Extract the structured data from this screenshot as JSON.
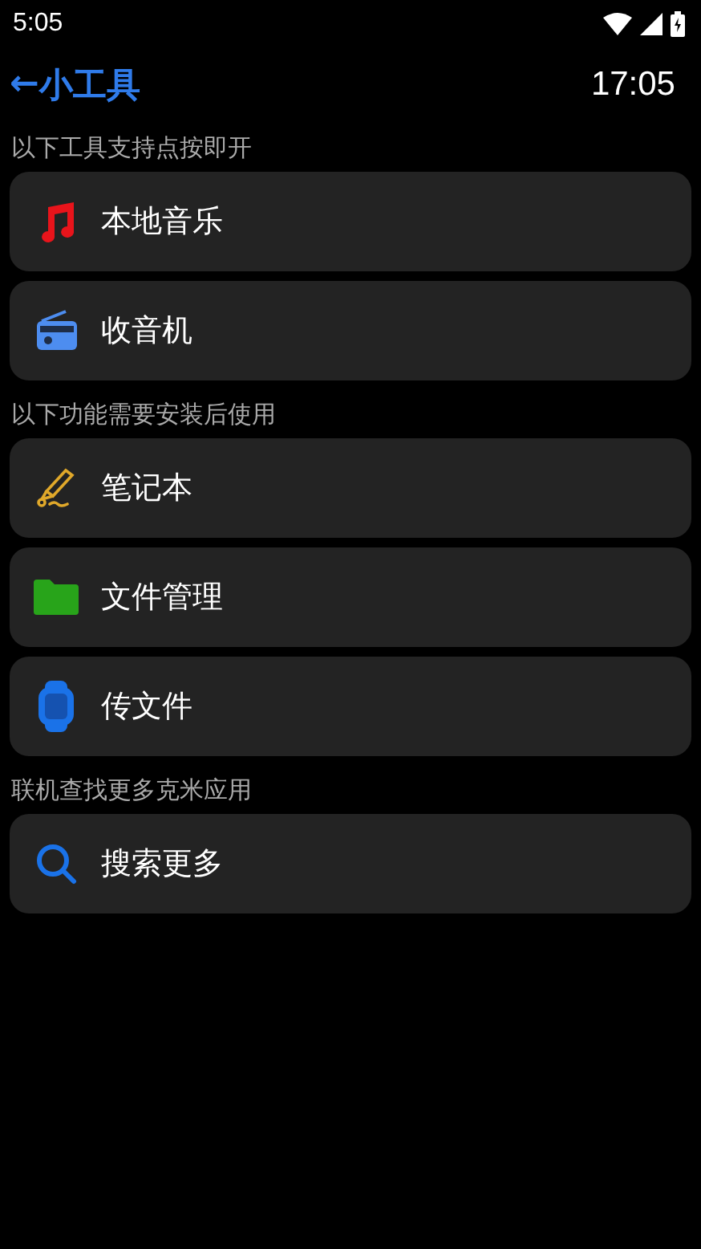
{
  "status_bar": {
    "time": "5:05"
  },
  "header": {
    "back_icon": "←",
    "title": "小工具",
    "clock": "17:05"
  },
  "sections": [
    {
      "label": "以下工具支持点按即开",
      "items": [
        {
          "kind": "music",
          "label": "本地音乐"
        },
        {
          "kind": "radio",
          "label": "收音机"
        }
      ]
    },
    {
      "label": "以下功能需要安装后使用",
      "items": [
        {
          "kind": "pen",
          "label": "笔记本"
        },
        {
          "kind": "folder",
          "label": "文件管理"
        },
        {
          "kind": "watch",
          "label": "传文件"
        }
      ]
    },
    {
      "label": "联机查找更多克米应用",
      "items": [
        {
          "kind": "search",
          "label": "搜索更多"
        }
      ]
    }
  ]
}
